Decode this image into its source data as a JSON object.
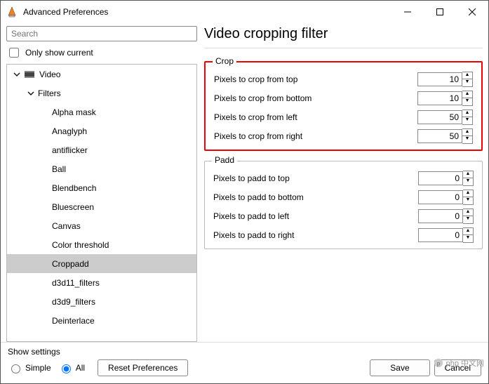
{
  "window": {
    "title": "Advanced Preferences",
    "min_icon": "minimize-icon",
    "max_icon": "maximize-icon",
    "close_icon": "close-icon"
  },
  "search": {
    "placeholder": "Search"
  },
  "only_show_label": "Only show current",
  "tree": {
    "root": "Video",
    "child": "Filters",
    "items": [
      "Alpha mask",
      "Anaglyph",
      "antiflicker",
      "Ball",
      "Blendbench",
      "Bluescreen",
      "Canvas",
      "Color threshold",
      "Croppadd",
      "d3d11_filters",
      "d3d9_filters",
      "Deinterlace"
    ],
    "selected_index": 8
  },
  "page_title": "Video cropping filter",
  "crop": {
    "legend": "Crop",
    "rows": [
      {
        "label": "Pixels to crop from top",
        "value": "10"
      },
      {
        "label": "Pixels to crop from bottom",
        "value": "10"
      },
      {
        "label": "Pixels to crop from left",
        "value": "50"
      },
      {
        "label": "Pixels to crop from right",
        "value": "50"
      }
    ]
  },
  "padd": {
    "legend": "Padd",
    "rows": [
      {
        "label": "Pixels to padd to top",
        "value": "0"
      },
      {
        "label": "Pixels to padd to bottom",
        "value": "0"
      },
      {
        "label": "Pixels to padd to left",
        "value": "0"
      },
      {
        "label": "Pixels to padd to right",
        "value": "0"
      }
    ]
  },
  "footer": {
    "show_settings": "Show settings",
    "simple": "Simple",
    "all": "All",
    "reset": "Reset Preferences",
    "save": "Save",
    "cancel": "Cancel"
  },
  "watermark": "php 中文网"
}
